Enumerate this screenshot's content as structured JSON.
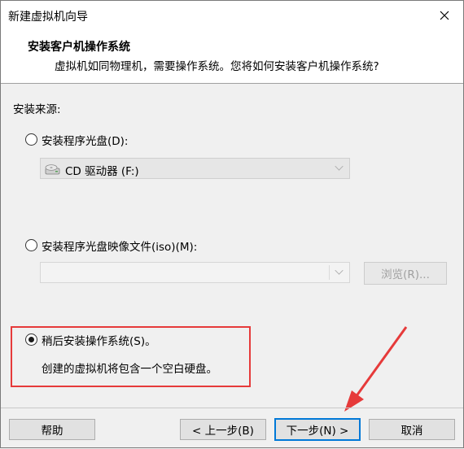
{
  "window": {
    "title": "新建虚拟机向导",
    "close_label": "✕"
  },
  "header": {
    "title": "安装客户机操作系统",
    "subtitle": "虚拟机如同物理机，需要操作系统。您将如何安装客户机操作系统?"
  },
  "source_label": "安装来源:",
  "options": {
    "disc": {
      "label": "安装程序光盘(D):",
      "selected": false
    },
    "drive_combo": {
      "value": "CD 驱动器 (F:)"
    },
    "iso": {
      "label": "安装程序光盘映像文件(iso)(M):",
      "selected": false
    },
    "iso_combo": {
      "value": ""
    },
    "browse_button": "浏览(R)...",
    "later": {
      "label": "稍后安装操作系统(S)。",
      "selected": true
    },
    "later_note": "创建的虚拟机将包含一个空白硬盘。"
  },
  "buttons": {
    "help": "帮助",
    "back": "< 上一步(B)",
    "next": "下一步(N) >",
    "cancel": "取消"
  },
  "colors": {
    "highlight": "#e63a3a",
    "focus": "#0078d7"
  }
}
